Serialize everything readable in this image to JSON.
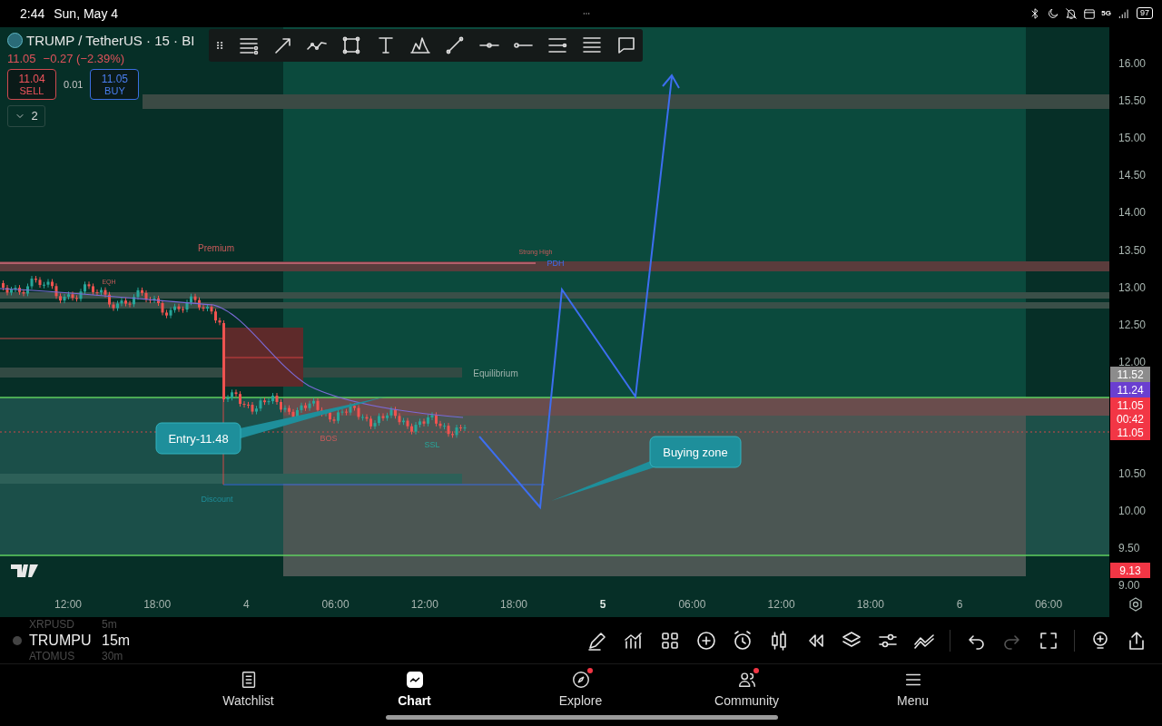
{
  "status_bar": {
    "time": "2:44",
    "date": "Sun, May 4",
    "battery": "97",
    "network": "5G"
  },
  "symbol": {
    "title": "TRUMP / TetherUS · 15 · BI",
    "price": "11.05",
    "change": "−0.27 (−2.39%)"
  },
  "trade": {
    "sell_price": "11.04",
    "sell_label": "SELL",
    "spread": "0.01",
    "buy_price": "11.05",
    "buy_label": "BUY"
  },
  "indicators": {
    "count": "2",
    "expanded": false
  },
  "chart": {
    "zone_labels": [
      {
        "kind": "premium",
        "text": "Premium"
      },
      {
        "kind": "eqh",
        "text": "EQH"
      },
      {
        "kind": "strong_high",
        "text": "Strong High"
      },
      {
        "kind": "pdh",
        "text": "PDH"
      },
      {
        "kind": "equilibrium",
        "text": "Equilibrium"
      },
      {
        "kind": "bos",
        "text": "BOS"
      },
      {
        "kind": "ssl",
        "text": "SSL"
      },
      {
        "kind": "discount",
        "text": "Discount"
      }
    ],
    "callouts": [
      {
        "kind": "entry",
        "text": "Entry-11.48"
      },
      {
        "kind": "zone",
        "text": "Buying zone"
      }
    ],
    "price_ticks": [
      "16.00",
      "15.50",
      "15.00",
      "14.50",
      "14.00",
      "13.50",
      "13.00",
      "12.50",
      "12.00",
      "10.50",
      "10.00",
      "9.50",
      "9.00"
    ],
    "price_tags": [
      {
        "lines": [
          "11.52"
        ],
        "color": "#8c8c8c"
      },
      {
        "lines": [
          "11.24"
        ],
        "color": "#6a3fd0"
      },
      {
        "lines": [
          "11.05",
          "00:42",
          "11.05"
        ],
        "color": "#f23645"
      },
      {
        "lines": [
          "9.13"
        ],
        "color": "#f23645"
      }
    ],
    "time_ticks": [
      {
        "label": "12:00",
        "emphasis": false
      },
      {
        "label": "18:00",
        "emphasis": false
      },
      {
        "label": "4",
        "emphasis": false
      },
      {
        "label": "06:00",
        "emphasis": false
      },
      {
        "label": "12:00",
        "emphasis": false
      },
      {
        "label": "18:00",
        "emphasis": false
      },
      {
        "label": "5",
        "emphasis": true
      },
      {
        "label": "06:00",
        "emphasis": false
      },
      {
        "label": "12:00",
        "emphasis": false
      },
      {
        "label": "18:00",
        "emphasis": false
      },
      {
        "label": "6",
        "emphasis": false
      },
      {
        "label": "06:00",
        "emphasis": false
      }
    ]
  },
  "watchlist_picker": [
    {
      "symbol": "XRPUSD",
      "interval": "5m",
      "selected": false
    },
    {
      "symbol": "TRUMPU",
      "interval": "15m",
      "selected": true
    },
    {
      "symbol": "ATOMUS",
      "interval": "30m",
      "selected": false
    }
  ],
  "nav": [
    {
      "label": "Watchlist",
      "selected": false,
      "badge": false
    },
    {
      "label": "Chart",
      "selected": true,
      "badge": false
    },
    {
      "label": "Explore",
      "selected": false,
      "badge": true
    },
    {
      "label": "Community",
      "selected": false,
      "badge": true
    },
    {
      "label": "Menu",
      "selected": false,
      "badge": false
    }
  ]
}
